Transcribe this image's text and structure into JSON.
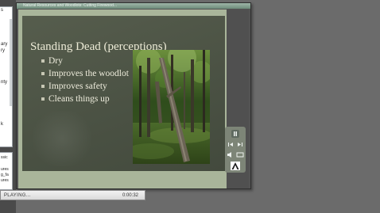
{
  "window": {
    "title": "Natural Resources and Woodlots: Cutting Firewood..."
  },
  "left_panel": {
    "top_card_lines": [
      "s",
      "",
      "ary",
      "ry",
      "",
      "",
      "nty",
      "",
      "",
      "",
      "k"
    ],
    "bottom_card_lines": [
      "ssic",
      "",
      "ures",
      "g_fa",
      "ures"
    ]
  },
  "slide": {
    "title": "Standing Dead (perceptions)",
    "bullets": [
      "Dry",
      "Improves the woodlot",
      "Improves safety",
      "Cleans things up"
    ],
    "photo_alt": "forest with leaning dead tree"
  },
  "controls": {
    "pause_icon": "pause-icon",
    "rewind_icon": "skip-back-icon",
    "forward_icon": "skip-forward-icon",
    "volume_icon": "volume-icon",
    "captions_icon": "captions-icon",
    "adobe_icon": "adobe-logo-icon"
  },
  "status": {
    "state": "PLAYING...",
    "time": "0:00:32"
  },
  "colors": {
    "background": "#6b6b6b",
    "frame_green": "#a9b59a",
    "slide_bg": "#4f5646",
    "titlebar": "#7f9e8c",
    "text": "#eeecdc"
  }
}
